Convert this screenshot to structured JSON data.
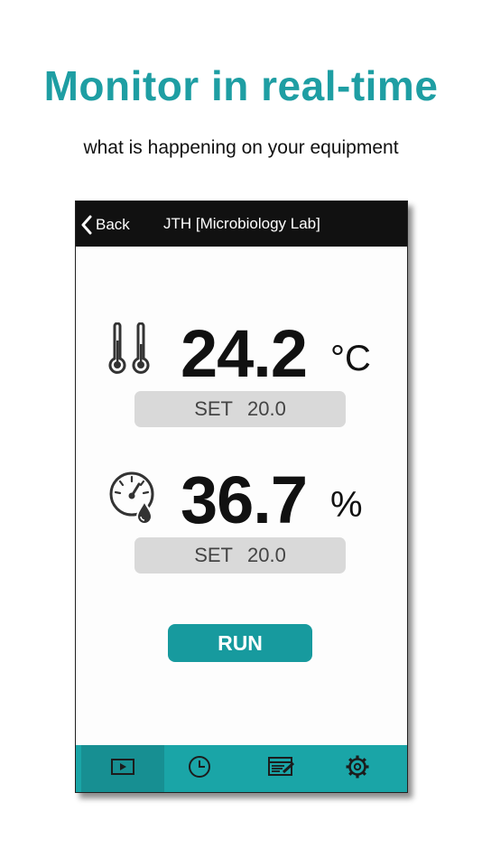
{
  "promo": {
    "headline": "Monitor in real-time",
    "subline": "what is happening on your equipment"
  },
  "navbar": {
    "back_label": "Back",
    "title": "JTH [Microbiology Lab]"
  },
  "temperature": {
    "icon": "thermometer-icon",
    "value": "24.2",
    "unit": "°C",
    "set_label": "SET",
    "set_value": "20.0"
  },
  "humidity": {
    "icon": "hygrometer-gauge-icon",
    "value": "36.7",
    "unit": "%",
    "set_label": "SET",
    "set_value": "20.0"
  },
  "run_button": {
    "label": "RUN"
  },
  "tabbar": {
    "tabs": [
      {
        "icon": "monitor-play-icon",
        "active": true
      },
      {
        "icon": "clock-icon",
        "active": false
      },
      {
        "icon": "log-edit-icon",
        "active": false
      },
      {
        "icon": "gear-icon",
        "active": false
      }
    ]
  },
  "colors": {
    "brand": "#1e9ea3",
    "navbar": "#111111",
    "tabbar": "#1aa5a7",
    "set_box": "#d9d9d9",
    "run_button": "#179a9e"
  }
}
